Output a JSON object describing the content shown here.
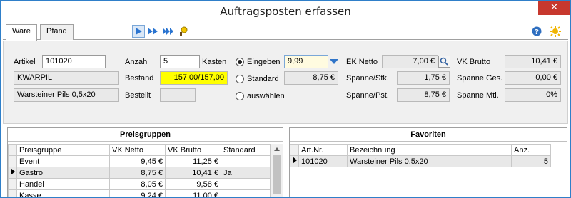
{
  "window": {
    "title": "Auftragsposten erfassen",
    "close_symbol": "✕"
  },
  "tabs": [
    {
      "label": "Ware",
      "active": true
    },
    {
      "label": "Pfand",
      "active": false
    }
  ],
  "toolbar": {
    "icons": [
      "play-icon",
      "fast-forward-icon",
      "fast-forward-end-icon",
      "wizard-icon"
    ],
    "right_icons": [
      "help-icon",
      "settings-icon"
    ]
  },
  "form": {
    "artikel_label": "Artikel",
    "artikel_value": "101020",
    "short_name": "KWARPIL",
    "description": "Warsteiner Pils 0,5x20",
    "anzahl_label": "Anzahl",
    "anzahl_value": "5",
    "anzahl_unit": "Kasten",
    "bestand_label": "Bestand",
    "bestand_value": "157,00/157,00",
    "bestellt_label": "Bestellt",
    "bestellt_value": "",
    "price_mode": {
      "eingeben_label": "Eingeben",
      "eingeben_value": "9,99",
      "standard_label": "Standard",
      "standard_value": "8,75 €",
      "auswaehlen_label": "auswählen",
      "selected": "Eingeben"
    },
    "ek_netto_label": "EK Netto",
    "ek_netto_value": "7,00 €",
    "spanne_stk_label": "Spanne/Stk.",
    "spanne_stk_value": "1,75 €",
    "spanne_pst_label": "Spanne/Pst.",
    "spanne_pst_value": "8,75 €",
    "vk_brutto_label": "VK Brutto",
    "vk_brutto_value": "10,41 €",
    "spanne_ges_label": "Spanne Ges.",
    "spanne_ges_value": "0,00 €",
    "spanne_mtl_label": "Spanne Mtl.",
    "spanne_mtl_value": "0%"
  },
  "preisgruppen": {
    "title": "Preisgruppen",
    "columns": [
      "Preisgruppe",
      "VK Netto",
      "VK Brutto",
      "Standard"
    ],
    "rows": [
      {
        "name": "Event",
        "netto": "9,45 €",
        "brutto": "11,25 €",
        "standard": ""
      },
      {
        "name": "Gastro",
        "netto": "8,75 €",
        "brutto": "10,41 €",
        "standard": "Ja"
      },
      {
        "name": "Handel",
        "netto": "8,05 €",
        "brutto": "9,58 €",
        "standard": ""
      },
      {
        "name": "Kasse",
        "netto": "9,24 €",
        "brutto": "11,00 €",
        "standard": ""
      }
    ],
    "selected_index": 1
  },
  "favoriten": {
    "title": "Favoriten",
    "columns": [
      "Art.Nr.",
      "Bezeichnung",
      "Anz."
    ],
    "rows": [
      {
        "artnr": "101020",
        "bezeichnung": "Warsteiner Pils 0,5x20",
        "anz": "5"
      }
    ],
    "selected_index": 0
  }
}
